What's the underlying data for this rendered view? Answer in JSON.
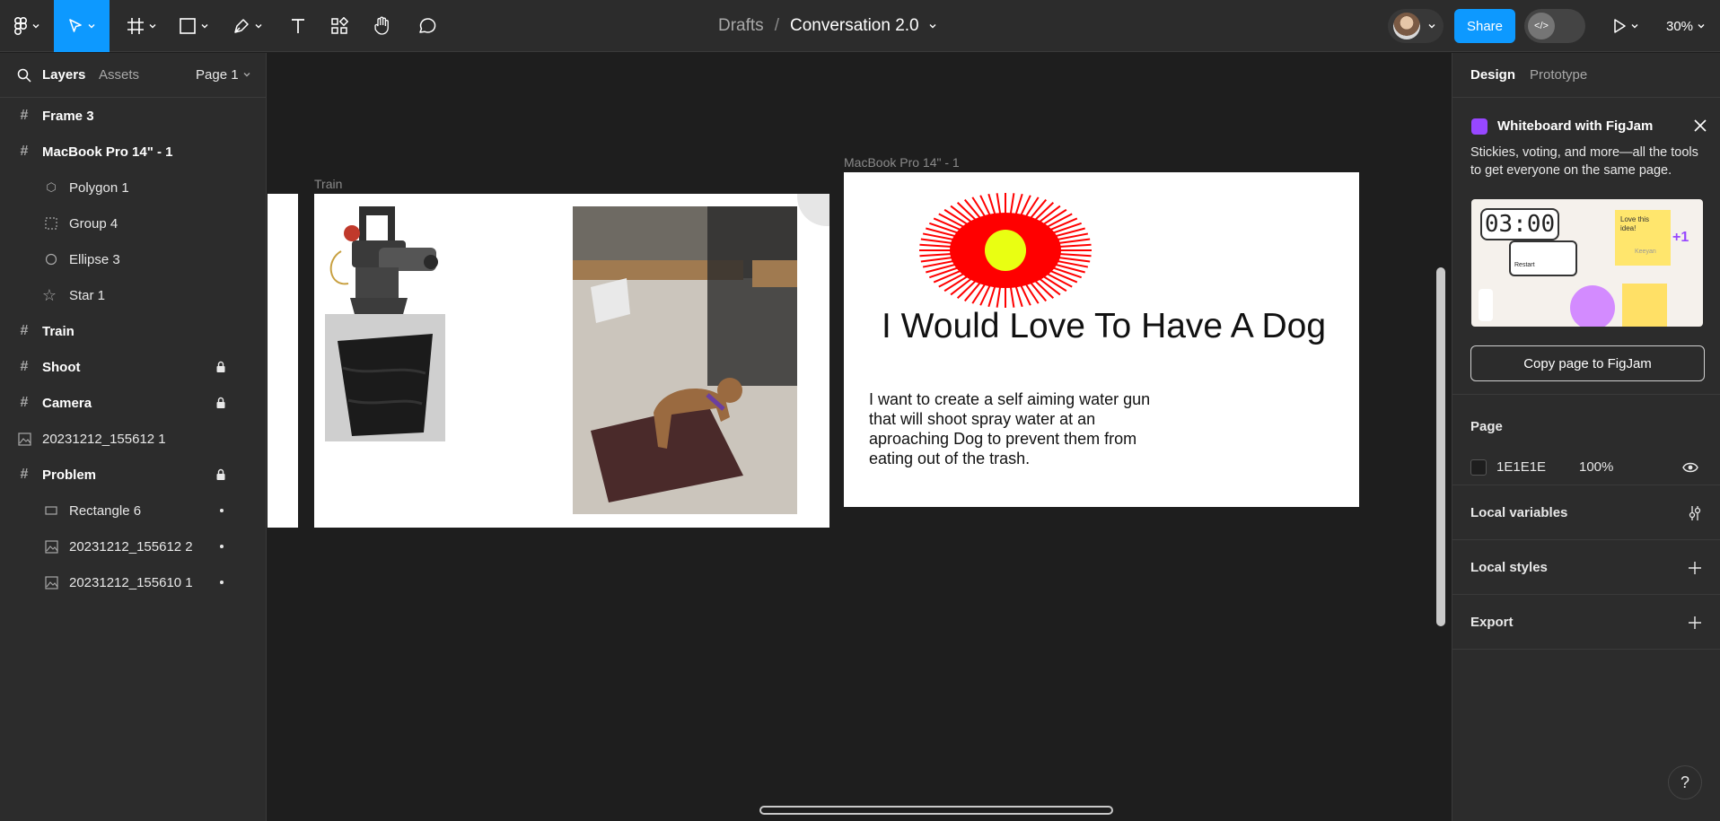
{
  "toolbar": {
    "breadcrumb_drafts": "Drafts",
    "breadcrumb_sep": "/",
    "file_name": "Conversation 2.0",
    "share_label": "Share",
    "zoom_label": "30%",
    "dev_mode_symbol": "</>"
  },
  "left_panel": {
    "tab_layers": "Layers",
    "tab_assets": "Assets",
    "page_label": "Page 1",
    "layers": [
      {
        "label": "Frame 3",
        "icon": "frame-icon"
      },
      {
        "label": "MacBook Pro 14\" - 1",
        "icon": "frame-icon"
      },
      {
        "label": "Polygon 1",
        "icon": "polygon-icon"
      },
      {
        "label": "Group 4",
        "icon": "group-icon"
      },
      {
        "label": "Ellipse 3",
        "icon": "ellipse-icon"
      },
      {
        "label": "Star 1",
        "icon": "star-icon"
      },
      {
        "label": "Train",
        "icon": "frame-icon"
      },
      {
        "label": "Shoot",
        "icon": "frame-icon",
        "locked": true
      },
      {
        "label": "Camera",
        "icon": "frame-icon",
        "locked": true
      },
      {
        "label": "20231212_155612 1",
        "icon": "image-icon"
      },
      {
        "label": "Problem",
        "icon": "frame-icon",
        "locked": true
      },
      {
        "label": "Rectangle 6",
        "icon": "rectangle-icon"
      },
      {
        "label": "20231212_155612 2",
        "icon": "image-icon"
      },
      {
        "label": "20231212_155610 1",
        "icon": "image-icon"
      }
    ]
  },
  "canvas": {
    "train_label": "Train",
    "macbook_label": "MacBook Pro 14\" - 1",
    "headline": "I Would Love To Have A Dog",
    "body_lines": [
      "I want to create a self aiming water gun",
      "that will shoot spray water at an",
      "aproaching Dog to prevent them from",
      "eating out of the trash."
    ]
  },
  "right_panel": {
    "tab_design": "Design",
    "tab_prototype": "Prototype",
    "figjam_title": "Whiteboard with FigJam",
    "figjam_desc": "Stickies, voting, and more—all the tools to get everyone on the same page.",
    "figjam_timer": "03:00",
    "figjam_sticky": "Love this idea!",
    "figjam_sticky_author": "Keeyan",
    "figjam_plus": "+1",
    "figjam_restart": "Restart",
    "copy_button": "Copy page to FigJam",
    "page_section": "Page",
    "page_color": "1E1E1E",
    "page_opacity": "100%",
    "local_variables": "Local variables",
    "local_styles": "Local styles",
    "export": "Export"
  },
  "help_label": "?",
  "colors": {
    "accent": "#0d99ff",
    "panel": "#2c2c2c",
    "canvas": "#1e1e1e",
    "figjam": "#9747ff"
  }
}
